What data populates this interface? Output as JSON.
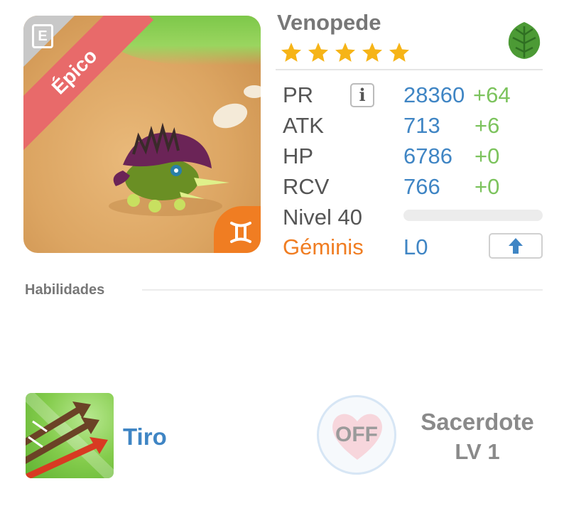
{
  "monster": {
    "rarity_label": "Épico",
    "name": "Venopede",
    "stars": 5,
    "element_icon": "leaf-icon",
    "zodiac_icon": "gemini-icon"
  },
  "stats": [
    {
      "label": "PR",
      "value": "28360",
      "bonus": "+64"
    },
    {
      "label": "ATK",
      "value": "713",
      "bonus": "+6"
    },
    {
      "label": "HP",
      "value": "6786",
      "bonus": "+0"
    },
    {
      "label": "RCV",
      "value": "766",
      "bonus": "+0"
    }
  ],
  "info_button": "i",
  "level": {
    "label": "Nivel 40",
    "xp_progress": 0
  },
  "zodiac": {
    "name": "Géminis",
    "level": "L0"
  },
  "abilities": {
    "title": "Habilidades",
    "skill": {
      "name": "Tiro",
      "icon": "arrows-icon"
    },
    "leader": {
      "status": "OFF",
      "name": "Sacerdote",
      "level": "LV 1"
    }
  },
  "colors": {
    "rarity": "#e86a6a",
    "zodiac": "#f07d22",
    "value": "#3f85c4",
    "bonus": "#7cc35d",
    "star": "#f6b417",
    "element": "#4c9a35"
  }
}
